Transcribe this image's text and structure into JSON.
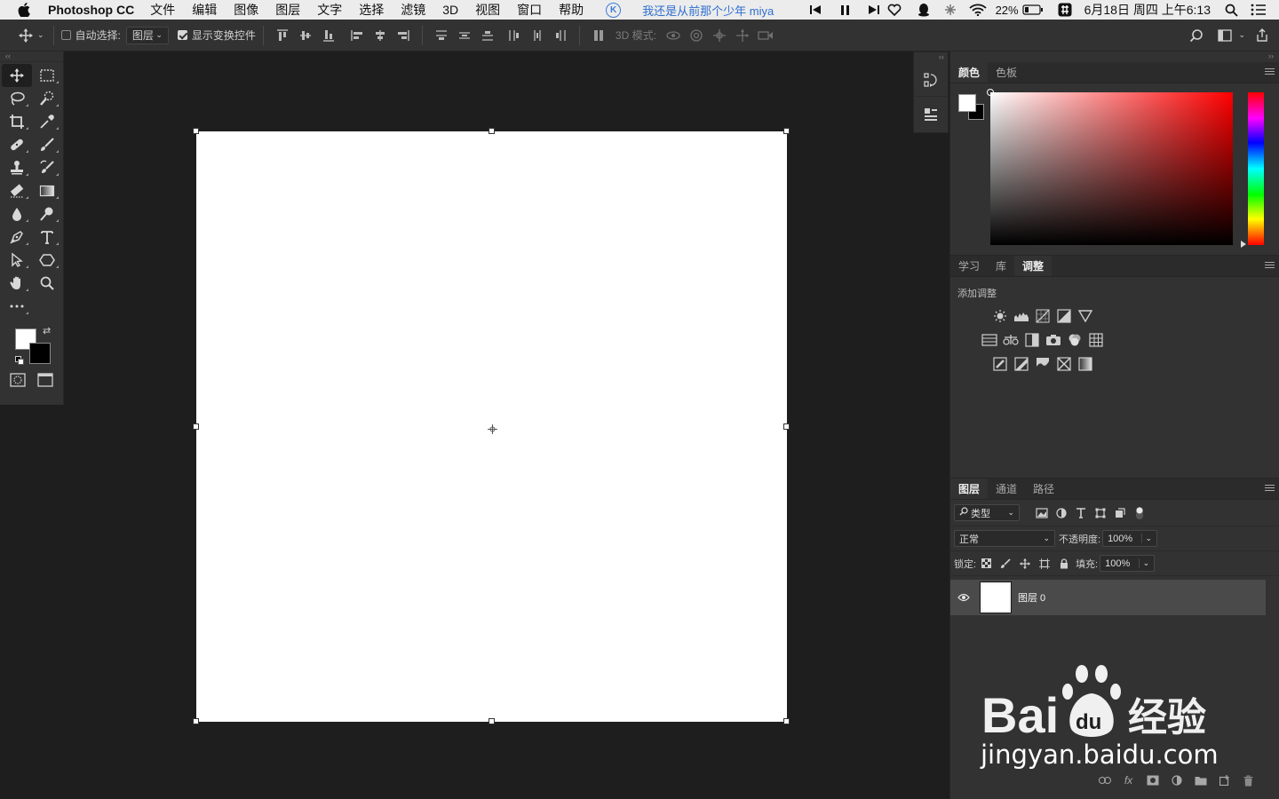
{
  "menubar": {
    "app_name": "Photoshop CC",
    "menus": [
      "文件",
      "编辑",
      "图像",
      "图层",
      "文字",
      "选择",
      "滤镜",
      "3D",
      "视图",
      "窗口",
      "帮助"
    ],
    "now_playing": "我还是从前那个少年 miya",
    "music_badge": "K",
    "battery": "22%",
    "datetime": "6月18日 周四 上午6:13"
  },
  "optionsbar": {
    "auto_select_label": "自动选择:",
    "auto_select_target": "图层",
    "show_transform_label": "显示变换控件",
    "mode_3d_label": "3D 模式:"
  },
  "color_panel": {
    "tabs": [
      "颜色",
      "色板"
    ],
    "fg_color": "#ffffff",
    "bg_color": "#000000",
    "hue": "#ff0000"
  },
  "adjust_panel": {
    "tabs": [
      "学习",
      "库",
      "调整"
    ],
    "title": "添加调整"
  },
  "layers_panel": {
    "tabs": [
      "图层",
      "通道",
      "路径"
    ],
    "filter_kind": "类型",
    "blend_mode": "正常",
    "opacity_label": "不透明度:",
    "opacity_value": "100%",
    "lock_label": "锁定:",
    "fill_label": "填充:",
    "fill_value": "100%",
    "layers": [
      {
        "name": "图层 0",
        "visible": true
      }
    ],
    "footer_fx": "fx"
  },
  "watermark": {
    "url": "jingyan.baidu.com"
  }
}
